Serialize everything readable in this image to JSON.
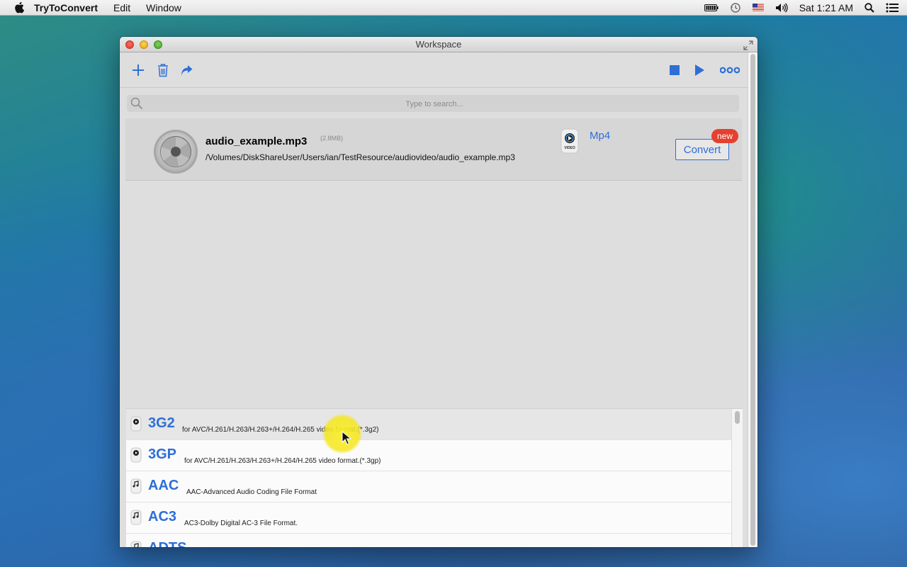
{
  "menubar": {
    "app_name": "TryToConvert",
    "items": [
      "Edit",
      "Window"
    ],
    "clock": "Sat 1:21 AM",
    "icons": [
      "battery-icon",
      "time-machine-icon",
      "us-flag-icon",
      "volume-icon",
      "spotlight-icon",
      "notification-center-icon"
    ]
  },
  "window": {
    "title": "Workspace"
  },
  "toolbar": {
    "left_icons": [
      "add-icon",
      "trash-icon",
      "share-icon"
    ],
    "right_icons": [
      "stop-icon",
      "play-icon",
      "more-icon"
    ]
  },
  "search": {
    "placeholder": "Type to search..."
  },
  "file": {
    "name": "audio_example.mp3",
    "size": "(2.8MB)",
    "path": "/Volumes/DiskShareUser/Users/ian/TestResource/audiovideo/audio_example.mp3",
    "format_label": "Mp4",
    "format_icon_text": "VIDEO",
    "convert_label": "Convert",
    "badge": "new"
  },
  "format_list": {
    "items": [
      {
        "name": "3G2",
        "desc": "for AVC/H.261/H.263/H.263+/H.264/H.265 video format.(*.3g2)",
        "kind": "VIDEO"
      },
      {
        "name": "3GP",
        "desc": "for AVC/H.261/H.263/H.263+/H.264/H.265 video format.(*.3gp)",
        "kind": "VIDEO"
      },
      {
        "name": "AAC",
        "desc": "AAC-Advanced Audio Coding File Format",
        "kind": "AUDIO"
      },
      {
        "name": "AC3",
        "desc": "AC3-Dolby Digital AC-3 File Format.",
        "kind": "AUDIO"
      },
      {
        "name": "ADTS",
        "desc": "",
        "kind": "AUDIO"
      }
    ],
    "selected_index": 0
  },
  "colors": {
    "accent": "#2e6fd6",
    "badge": "#e5412f"
  }
}
